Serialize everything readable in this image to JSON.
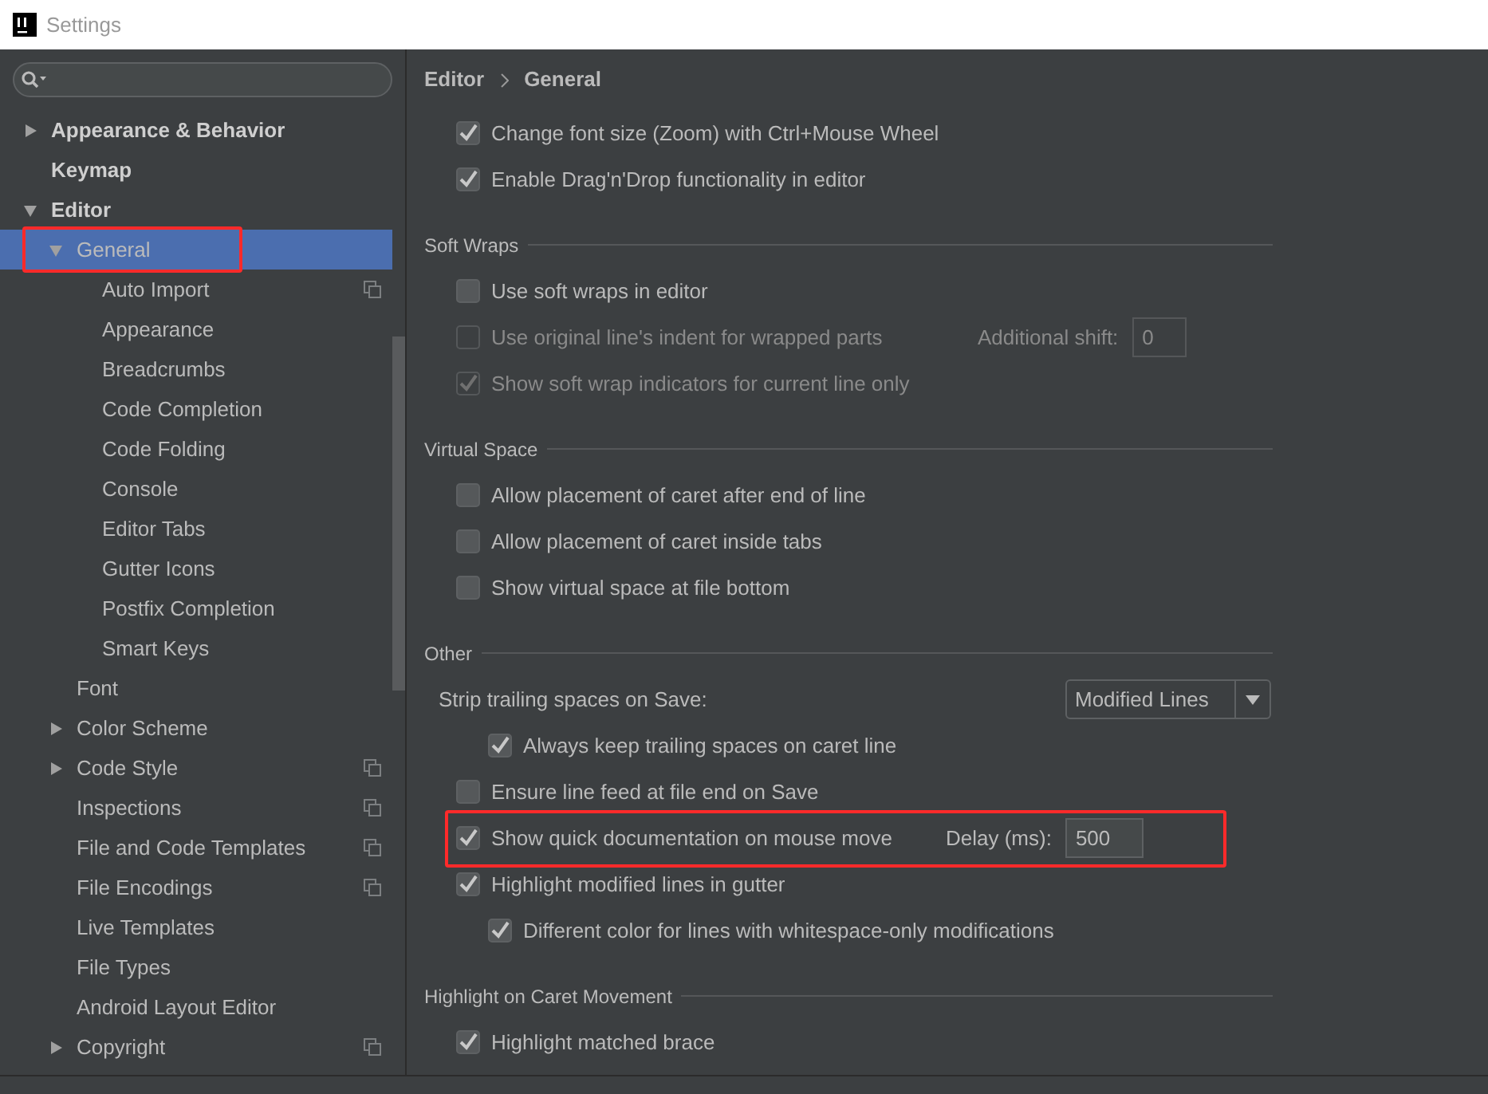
{
  "window": {
    "title": "Settings"
  },
  "sidebar": {
    "items": [
      {
        "label": "Appearance & Behavior",
        "expanded": false,
        "selected": false,
        "project_scope": false,
        "highlighted": false
      },
      {
        "label": "Keymap",
        "selected": false,
        "project_scope": false,
        "highlighted": false
      },
      {
        "label": "Editor",
        "expanded": true,
        "selected": false,
        "project_scope": false,
        "highlighted": false,
        "children": [
          {
            "label": "General",
            "expanded": true,
            "selected": true,
            "project_scope": false,
            "highlighted": true,
            "children": [
              {
                "label": "Auto Import",
                "selected": false,
                "project_scope": true,
                "highlighted": false
              },
              {
                "label": "Appearance",
                "selected": false,
                "project_scope": false,
                "highlighted": false
              },
              {
                "label": "Breadcrumbs",
                "selected": false,
                "project_scope": false,
                "highlighted": false
              },
              {
                "label": "Code Completion",
                "selected": false,
                "project_scope": false,
                "highlighted": false
              },
              {
                "label": "Code Folding",
                "selected": false,
                "project_scope": false,
                "highlighted": false
              },
              {
                "label": "Console",
                "selected": false,
                "project_scope": false,
                "highlighted": false
              },
              {
                "label": "Editor Tabs",
                "selected": false,
                "project_scope": false,
                "highlighted": false
              },
              {
                "label": "Gutter Icons",
                "selected": false,
                "project_scope": false,
                "highlighted": false
              },
              {
                "label": "Postfix Completion",
                "selected": false,
                "project_scope": false,
                "highlighted": false
              },
              {
                "label": "Smart Keys",
                "selected": false,
                "project_scope": false,
                "highlighted": false
              }
            ]
          },
          {
            "label": "Font",
            "selected": false,
            "project_scope": false,
            "highlighted": false
          },
          {
            "label": "Color Scheme",
            "expanded": false,
            "selected": false,
            "project_scope": false,
            "highlighted": false
          },
          {
            "label": "Code Style",
            "expanded": false,
            "selected": false,
            "project_scope": true,
            "highlighted": false
          },
          {
            "label": "Inspections",
            "selected": false,
            "project_scope": true,
            "highlighted": false
          },
          {
            "label": "File and Code Templates",
            "selected": false,
            "project_scope": true,
            "highlighted": false
          },
          {
            "label": "File Encodings",
            "selected": false,
            "project_scope": true,
            "highlighted": false
          },
          {
            "label": "Live Templates",
            "selected": false,
            "project_scope": false,
            "highlighted": false
          },
          {
            "label": "File Types",
            "selected": false,
            "project_scope": false,
            "highlighted": false
          },
          {
            "label": "Android Layout Editor",
            "selected": false,
            "project_scope": false,
            "highlighted": false
          },
          {
            "label": "Copyright",
            "expanded": false,
            "selected": false,
            "project_scope": true,
            "highlighted": false
          }
        ]
      }
    ]
  },
  "content": {
    "breadcrumb": [
      "Editor",
      "General"
    ],
    "sections": [
      {
        "rows": [
          {
            "kind": "checkbox",
            "label": "Change font size (Zoom) with Ctrl+Mouse Wheel",
            "checked": true,
            "disabled": false
          },
          {
            "kind": "checkbox",
            "label": "Enable Drag'n'Drop functionality in editor",
            "checked": true,
            "disabled": false
          }
        ]
      },
      {
        "title": "Soft Wraps",
        "rows": [
          {
            "kind": "checkbox",
            "label": "Use soft wraps in editor",
            "checked": false,
            "disabled": false
          },
          {
            "kind": "checkbox",
            "label": "Use original line's indent for wrapped parts",
            "checked": false,
            "disabled": true,
            "field": {
              "label": "Additional shift:",
              "value": "0"
            }
          },
          {
            "kind": "checkbox",
            "label": "Show soft wrap indicators for current line only",
            "checked": true,
            "disabled": true
          }
        ]
      },
      {
        "title": "Virtual Space",
        "rows": [
          {
            "kind": "checkbox",
            "label": "Allow placement of caret after end of line",
            "checked": false,
            "disabled": false
          },
          {
            "kind": "checkbox",
            "label": "Allow placement of caret inside tabs",
            "checked": false,
            "disabled": false
          },
          {
            "kind": "checkbox",
            "label": "Show virtual space at file bottom",
            "checked": false,
            "disabled": false
          }
        ]
      },
      {
        "title": "Other",
        "rows": [
          {
            "kind": "dropdown",
            "label": "Strip trailing spaces on Save:",
            "value": "Modified Lines",
            "children": [
              {
                "kind": "checkbox",
                "label": "Always keep trailing spaces on caret line",
                "checked": true,
                "disabled": false
              }
            ]
          },
          {
            "kind": "checkbox",
            "label": "Ensure line feed at file end on Save",
            "checked": false,
            "disabled": false
          },
          {
            "kind": "checkbox",
            "label": "Show quick documentation on mouse move",
            "checked": true,
            "disabled": false,
            "highlighted": true,
            "field": {
              "label": "Delay (ms):",
              "value": "500"
            }
          },
          {
            "kind": "checkbox",
            "label": "Highlight modified lines in gutter",
            "checked": true,
            "disabled": false,
            "children": [
              {
                "kind": "checkbox",
                "label": "Different color for lines with whitespace-only modifications",
                "checked": true,
                "disabled": false
              }
            ]
          }
        ]
      },
      {
        "title": "Highlight on Caret Movement",
        "rows": [
          {
            "kind": "checkbox",
            "label": "Highlight matched brace",
            "checked": true,
            "disabled": false
          }
        ]
      }
    ]
  }
}
